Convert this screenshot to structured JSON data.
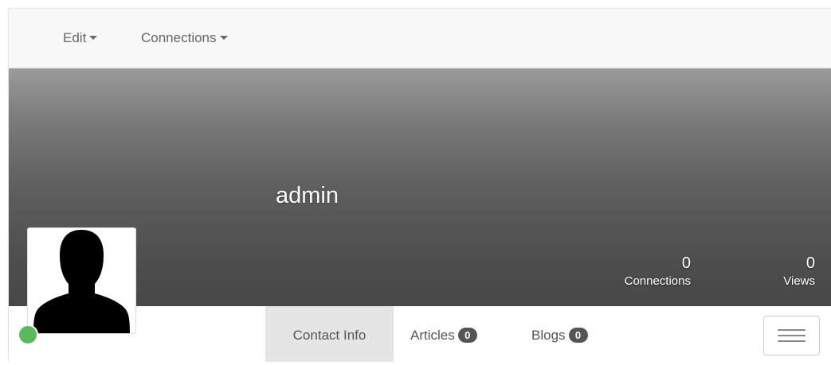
{
  "navbar": {
    "menus": [
      {
        "label": "Edit",
        "icon": "caret-down-icon"
      },
      {
        "label": "Connections",
        "icon": "caret-down-icon"
      }
    ]
  },
  "profile": {
    "name": "admin",
    "avatar_icon": "user-silhouette-icon",
    "online_status_color": "#5cb85c"
  },
  "stats": [
    {
      "value": "0",
      "label": "Connections"
    },
    {
      "value": "0",
      "label": "Views"
    }
  ],
  "tabs": [
    {
      "label": "Contact Info",
      "badge": null,
      "active": true
    },
    {
      "label": "Articles",
      "badge": "0",
      "active": false
    },
    {
      "label": "Blogs",
      "badge": "0",
      "active": false
    }
  ],
  "menu_toggle_icon": "hamburger-menu-icon"
}
